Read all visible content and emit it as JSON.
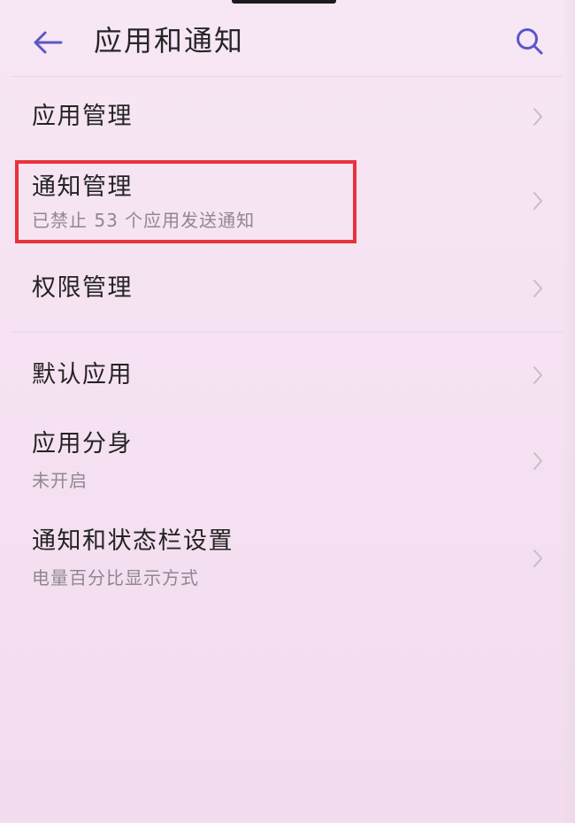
{
  "header": {
    "title": "应用和通知"
  },
  "items": [
    {
      "title": "应用管理",
      "subtitle": ""
    },
    {
      "title": "通知管理",
      "subtitle": "已禁止 53 个应用发送通知"
    },
    {
      "title": "权限管理",
      "subtitle": ""
    },
    {
      "title": "默认应用",
      "subtitle": ""
    },
    {
      "title": "应用分身",
      "subtitle": "未开启"
    },
    {
      "title": "通知和状态栏设置",
      "subtitle": "电量百分比显示方式"
    }
  ],
  "icons": {
    "back": "arrow-left-icon",
    "search": "search-icon",
    "chevron": "chevron-right-icon"
  },
  "colors": {
    "accent": "#5b56c8",
    "highlight": "#e8333a",
    "background": "#f6e3f2"
  }
}
